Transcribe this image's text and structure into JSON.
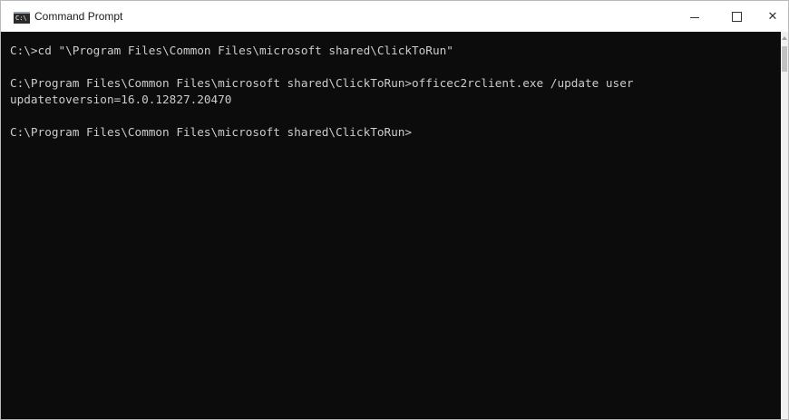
{
  "window": {
    "title": "Command Prompt",
    "icon": "cmd-icon",
    "controls": {
      "minimize_icon": "minimize-icon",
      "maximize_icon": "maximize-icon",
      "close_icon": "close-icon",
      "close_glyph": "✕"
    }
  },
  "console": {
    "lines": [
      "C:\\>cd \"\\Program Files\\Common Files\\microsoft shared\\ClickToRun\"",
      "",
      "C:\\Program Files\\Common Files\\microsoft shared\\ClickToRun>officec2rclient.exe /update user",
      "updatetoversion=16.0.12827.20470",
      "",
      "C:\\Program Files\\Common Files\\microsoft shared\\ClickToRun>"
    ]
  },
  "colors": {
    "console_bg": "#0c0c0c",
    "console_text": "#cccccc",
    "titlebar_bg": "#ffffff"
  }
}
